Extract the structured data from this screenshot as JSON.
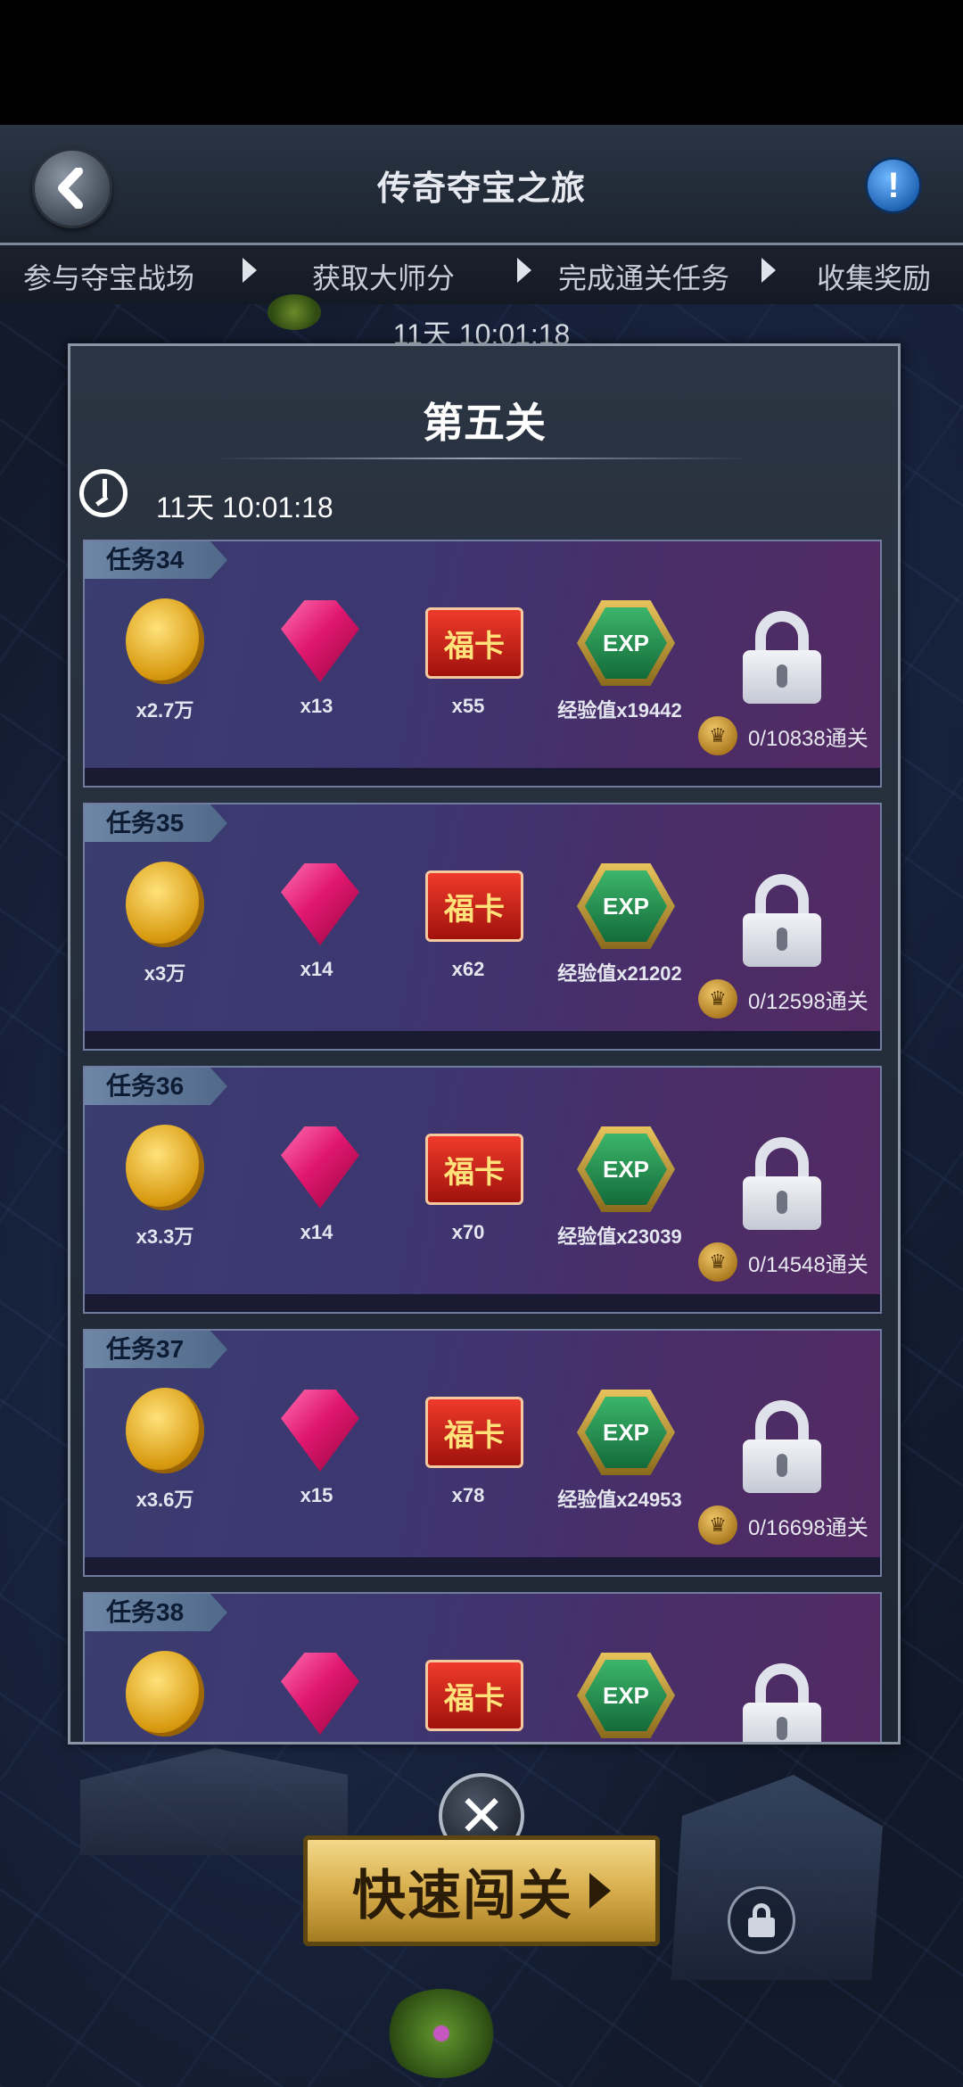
{
  "header": {
    "title": "传奇夺宝之旅",
    "info_label": "!"
  },
  "steps": [
    {
      "label": "参与夺宝战场"
    },
    {
      "label": "获取大师分"
    },
    {
      "label": "完成通关任务"
    },
    {
      "label": "收集奖励"
    }
  ],
  "countdown": "11天 10:01:18",
  "panel": {
    "title": "第五关",
    "timer": "11天 10:01:18"
  },
  "tasks": [
    {
      "name": "任务34",
      "coins": "x2.7万",
      "gems": "x13",
      "cards": "x55",
      "exp": "经验值x19442",
      "progress": "0/10838通关"
    },
    {
      "name": "任务35",
      "coins": "x3万",
      "gems": "x14",
      "cards": "x62",
      "exp": "经验值x21202",
      "progress": "0/12598通关"
    },
    {
      "name": "任务36",
      "coins": "x3.3万",
      "gems": "x14",
      "cards": "x70",
      "exp": "经验值x23039",
      "progress": "0/14548通关"
    },
    {
      "name": "任务37",
      "coins": "x3.6万",
      "gems": "x15",
      "cards": "x78",
      "exp": "经验值x24953",
      "progress": "0/16698通关"
    },
    {
      "name": "任务38",
      "coins": "",
      "gems": "",
      "cards": "",
      "exp": "",
      "progress": ""
    }
  ],
  "icons": {
    "card_text": "福卡",
    "exp_text": "EXP",
    "crown_text": "♛"
  },
  "close_label": "✕",
  "quick_button": {
    "label": "快速闯关"
  },
  "colors": {
    "gold": "#d7ad4c",
    "task_bg": "#4b2d68",
    "header_bg": "#2a3443"
  }
}
